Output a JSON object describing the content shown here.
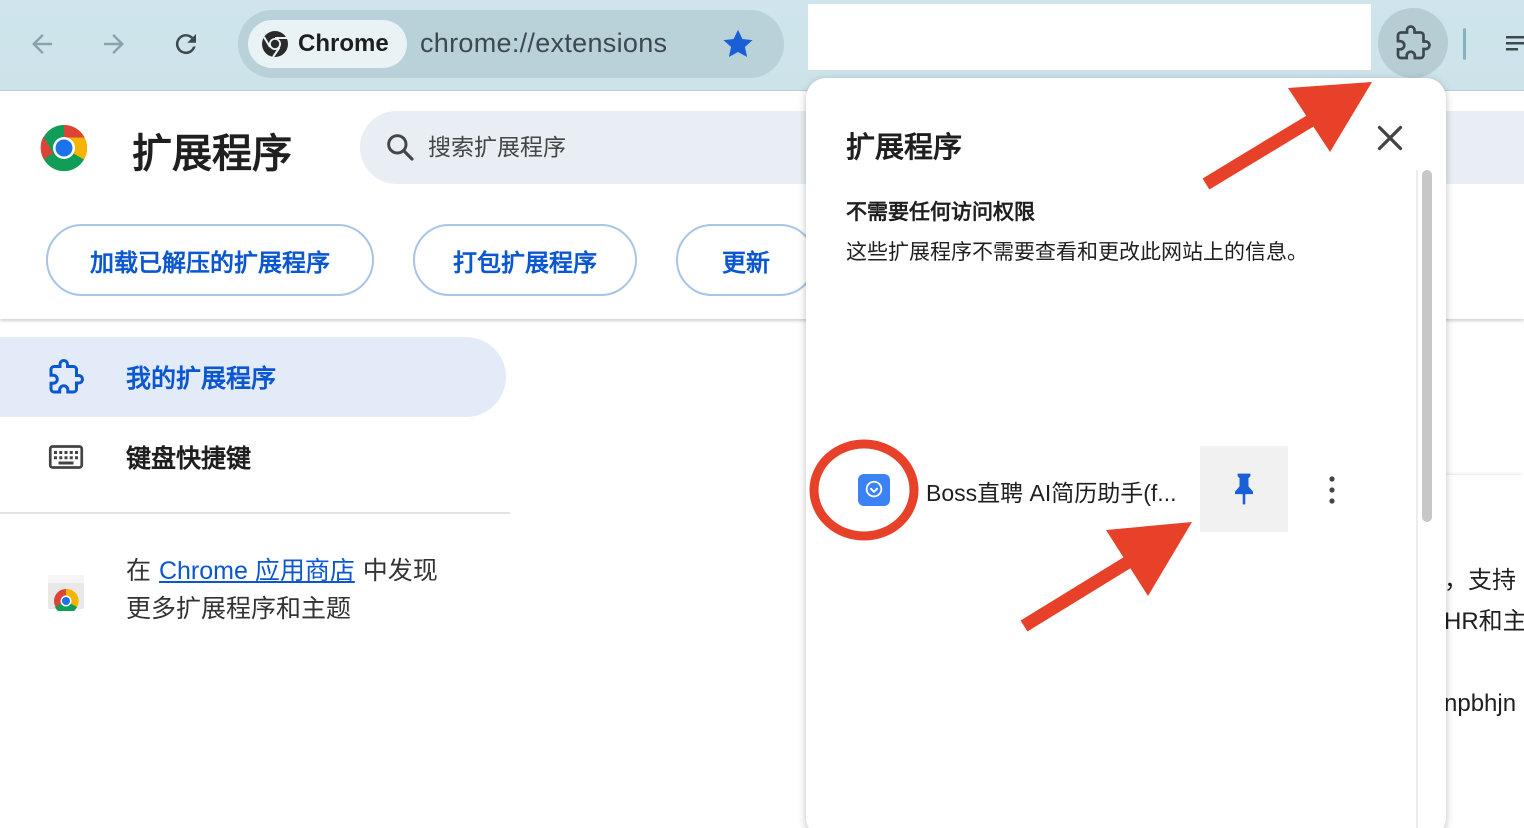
{
  "toolbar": {
    "back_icon": "arrow-left-icon",
    "forward_icon": "arrow-right-icon",
    "reload_icon": "reload-icon",
    "chip_label": "Chrome",
    "url": "chrome://extensions",
    "bookmark_icon": "star-icon",
    "extensions_icon": "puzzle-icon"
  },
  "page": {
    "title": "扩展程序",
    "search_placeholder": "搜索扩展程序",
    "buttons": {
      "load_unpacked": "加载已解压的扩展程序",
      "pack": "打包扩展程序",
      "update": "更新"
    },
    "sidebar": {
      "items": [
        {
          "label": "我的扩展程序",
          "icon": "puzzle-icon",
          "active": true
        },
        {
          "label": "键盘快捷键",
          "icon": "keyboard-icon",
          "active": false
        }
      ]
    },
    "store": {
      "prefix": "在 ",
      "link": "Chrome 应用商店",
      "suffix": " 中发现",
      "line2": "更多扩展程序和主题"
    },
    "card_fragments": [
      "，支持",
      "HR和主",
      "npbhjn"
    ]
  },
  "popup": {
    "title": "扩展程序",
    "section_title": "不需要任何访问权限",
    "section_desc": "这些扩展程序不需要查看和更改此网站上的信息。",
    "extension": {
      "name": "Boss直聘 AI简历助手(f...",
      "pin_icon": "pin-icon",
      "more_icon": "more-vert-icon"
    }
  },
  "colors": {
    "accent": "#0b57d0",
    "annotation": "#e8412a"
  }
}
